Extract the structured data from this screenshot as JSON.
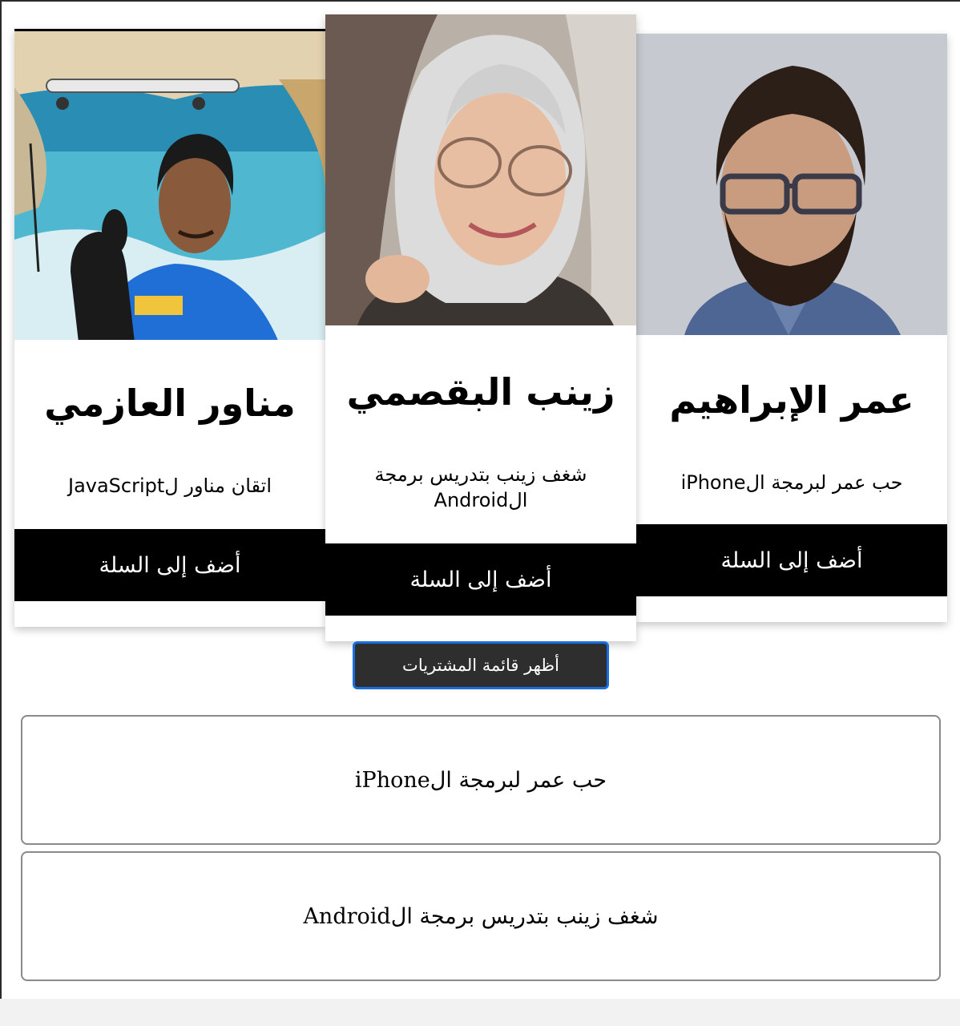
{
  "cards": [
    {
      "name": "مناور العازمي",
      "description": "اتقان مناور لJavaScript",
      "button_label": "أضف إلى السلة",
      "photo": "man-on-boat-thumbs-up"
    },
    {
      "name": "زينب البقصمي",
      "description": "شغف زينب بتدريس برمجة الAndroid",
      "button_label": "أضف إلى السلة",
      "photo": "woman-in-hijab-glasses"
    },
    {
      "name": "عمر الإبراهيم",
      "description": "حب عمر لبرمجة الiPhone",
      "button_label": "أضف إلى السلة",
      "photo": "bearded-man-glasses"
    }
  ],
  "show_list_button": "أظهر قائمة المشتريات",
  "purchase_list": [
    "حب عمر لبرمجة الiPhone",
    "شغف زينب بتدريس برمجة الAndroid"
  ],
  "colors": {
    "button_bg": "#000000",
    "show_button_bg": "#2e2e2e",
    "focus_ring": "#1a6fe0",
    "list_border": "#8a8a8a"
  }
}
